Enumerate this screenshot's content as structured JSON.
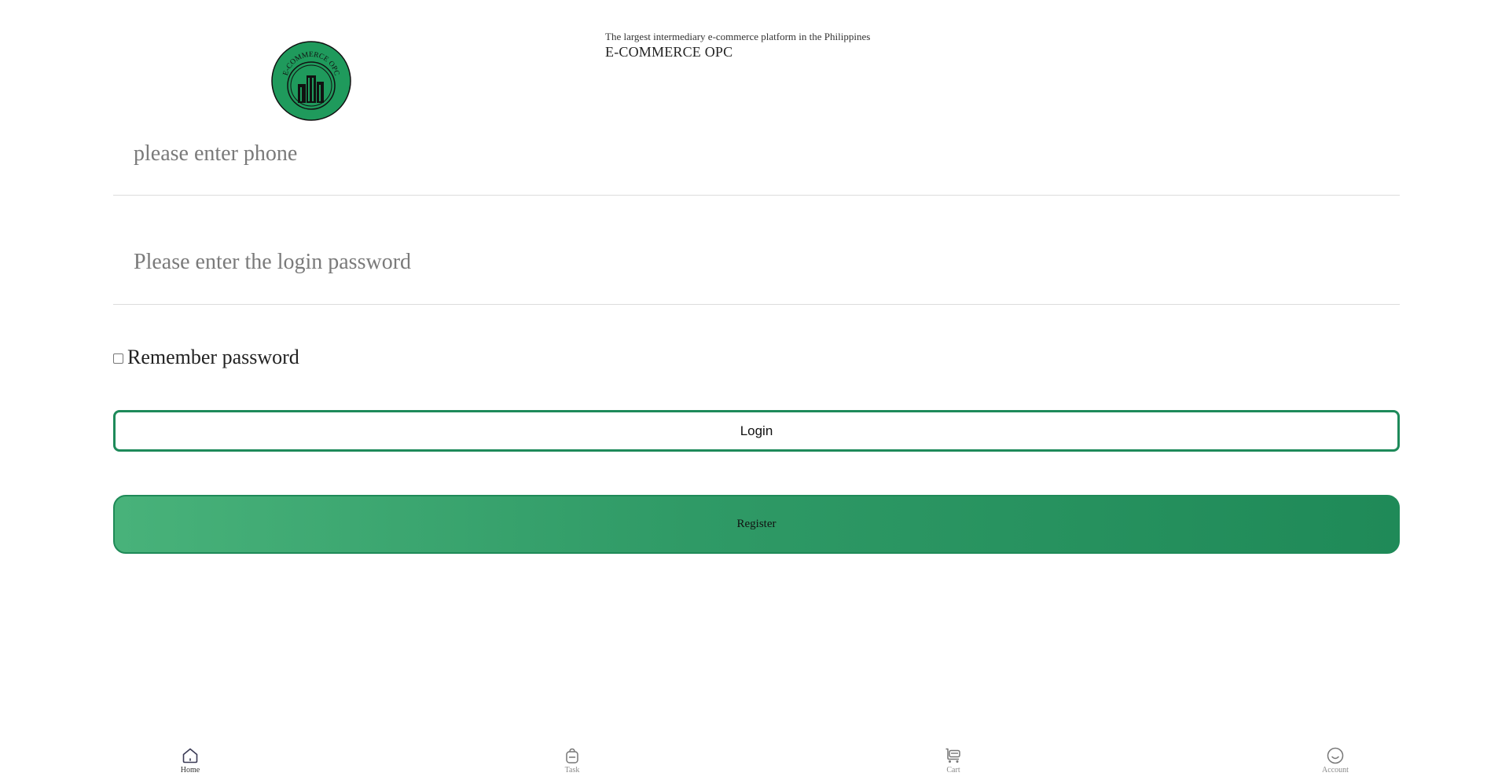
{
  "header": {
    "logo_text": "E-COMMERCE OPC",
    "tagline": "The largest intermediary e-commerce platform in the Philippines",
    "brand": "E-COMMERCE OPC"
  },
  "form": {
    "phone_placeholder": "please enter phone",
    "phone_value": "",
    "password_placeholder": "Please enter the login password",
    "password_value": "",
    "remember_label": "Remember password",
    "remember_checked": false,
    "login_label": "Login",
    "register_label": "Register"
  },
  "colors": {
    "accent": "#1e8a5a",
    "register_gradient_start": "#48b27a",
    "register_gradient_end": "#1f8a58",
    "logo_green": "#1f9a5c"
  },
  "tabbar": {
    "items": [
      {
        "label": "Home",
        "icon": "home-icon",
        "active": true
      },
      {
        "label": "Task",
        "icon": "bag-icon",
        "active": false
      },
      {
        "label": "Cart",
        "icon": "cart-icon",
        "active": false
      },
      {
        "label": "Account",
        "icon": "smile-icon",
        "active": false
      }
    ]
  }
}
